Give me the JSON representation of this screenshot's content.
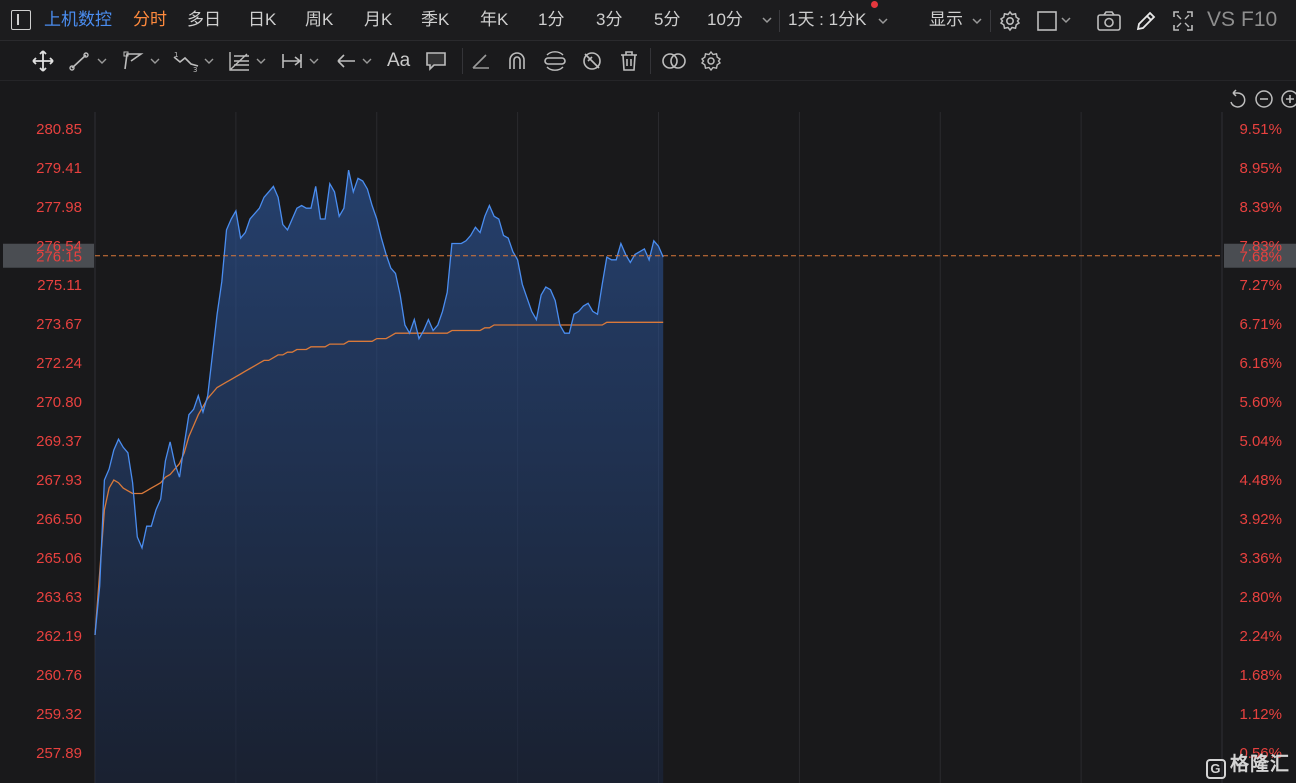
{
  "topbar": {
    "stock_name": "上机数控",
    "tabs": [
      "分时",
      "多日",
      "日K",
      "周K",
      "月K",
      "季K",
      "年K",
      "1分",
      "3分",
      "5分",
      "10分"
    ],
    "active_tab": "分时",
    "period_select": "1天 : 1分K",
    "display_label": "显示",
    "vs_label": "VS",
    "f10_label": "F10"
  },
  "toolbar": {
    "font_label": "Aa"
  },
  "watermark": "格隆汇",
  "colors": {
    "background": "#19191b",
    "price_line": "#4a8df0",
    "avg_line": "#d9793a",
    "axis_text": "#e8413f",
    "active_tab": "#ff8a3d",
    "grid": "#2a2a2e"
  },
  "chart_data": {
    "type": "line",
    "subtype": "intraday-time-sharing",
    "y_left_ticks": [
      "280.85",
      "279.41",
      "277.98",
      "276.54",
      "275.11",
      "273.67",
      "272.24",
      "270.80",
      "269.37",
      "267.93",
      "266.50",
      "265.06",
      "263.63",
      "262.19",
      "260.76",
      "259.32",
      "257.89"
    ],
    "y_right_ticks": [
      "9.51%",
      "8.95%",
      "8.39%",
      "7.83%",
      "7.27%",
      "6.71%",
      "6.16%",
      "5.60%",
      "5.04%",
      "4.48%",
      "3.92%",
      "3.36%",
      "2.80%",
      "2.24%",
      "1.68%",
      "1.12%",
      "0.56%"
    ],
    "ylim": [
      257.89,
      280.85
    ],
    "current_price": "276.15",
    "current_change": "7.68%",
    "session_minutes": 240,
    "grid": true,
    "series": [
      {
        "values": [
          262.2,
          264.0,
          267.9,
          268.3,
          269.0,
          269.4,
          269.1,
          268.9,
          267.8,
          265.8,
          265.4,
          266.2,
          266.2,
          266.8,
          267.2,
          268.6,
          269.3,
          268.5,
          268.0,
          269.2,
          270.3,
          270.5,
          271.0,
          270.4,
          271.0,
          272.5,
          274.0,
          275.2,
          277.1,
          277.5,
          277.8,
          276.8,
          277.0,
          277.5,
          277.7,
          277.9,
          278.3,
          278.5,
          278.7,
          278.3,
          277.3,
          277.1,
          277.5,
          277.9,
          278.0,
          277.9,
          277.9,
          278.7,
          277.5,
          277.5,
          278.8,
          278.5,
          277.6,
          277.9,
          279.3,
          278.5,
          279.0,
          278.9,
          278.6,
          278.0,
          277.5,
          276.8,
          276.2,
          275.7,
          275.5,
          274.7,
          273.6,
          273.3,
          273.8,
          273.1,
          273.4,
          273.8,
          273.4,
          273.6,
          274.1,
          274.8,
          276.6,
          276.6,
          276.6,
          276.7,
          276.9,
          277.2,
          277.0,
          277.6,
          278.0,
          277.6,
          277.5,
          276.9,
          276.8,
          276.3,
          276.0,
          275.1,
          274.6,
          274.1,
          273.8,
          274.7,
          275.0,
          274.9,
          274.5,
          273.6,
          273.3,
          273.3,
          274.0,
          274.1,
          274.3,
          274.4,
          274.1,
          274.0,
          275.1,
          276.1,
          276.0,
          276.0,
          276.6,
          276.2,
          275.9,
          276.2,
          276.3,
          276.4,
          276.0,
          276.7,
          276.5,
          276.1
        ],
        "x_step": 2
      },
      {
        "values": [
          262.2,
          264.5,
          266.8,
          267.6,
          267.9,
          267.8,
          267.6,
          267.5,
          267.4,
          267.4,
          267.4,
          267.5,
          267.6,
          267.7,
          267.8,
          268.0,
          268.1,
          268.3,
          268.5,
          268.9,
          269.5,
          269.9,
          270.3,
          270.6,
          270.9,
          271.1,
          271.3,
          271.4,
          271.5,
          271.6,
          271.7,
          271.8,
          271.9,
          272.0,
          272.1,
          272.2,
          272.3,
          272.3,
          272.4,
          272.5,
          272.5,
          272.6,
          272.6,
          272.7,
          272.7,
          272.7,
          272.8,
          272.8,
          272.8,
          272.8,
          272.9,
          272.9,
          272.9,
          272.9,
          273.0,
          273.0,
          273.0,
          273.0,
          273.0,
          273.0,
          273.1,
          273.1,
          273.1,
          273.2,
          273.3,
          273.3,
          273.3,
          273.3,
          273.3,
          273.3,
          273.3,
          273.3,
          273.3,
          273.3,
          273.3,
          273.3,
          273.4,
          273.4,
          273.4,
          273.4,
          273.4,
          273.4,
          273.4,
          273.5,
          273.5,
          273.6,
          273.6,
          273.6,
          273.6,
          273.6,
          273.6,
          273.6,
          273.6,
          273.6,
          273.6,
          273.6,
          273.6,
          273.6,
          273.6,
          273.6,
          273.6,
          273.6,
          273.6,
          273.6,
          273.6,
          273.6,
          273.6,
          273.6,
          273.6,
          273.7,
          273.7,
          273.7,
          273.7,
          273.7,
          273.7,
          273.7,
          273.7,
          273.7,
          273.7,
          273.7,
          273.7,
          273.7
        ],
        "x_step": 2
      }
    ]
  }
}
